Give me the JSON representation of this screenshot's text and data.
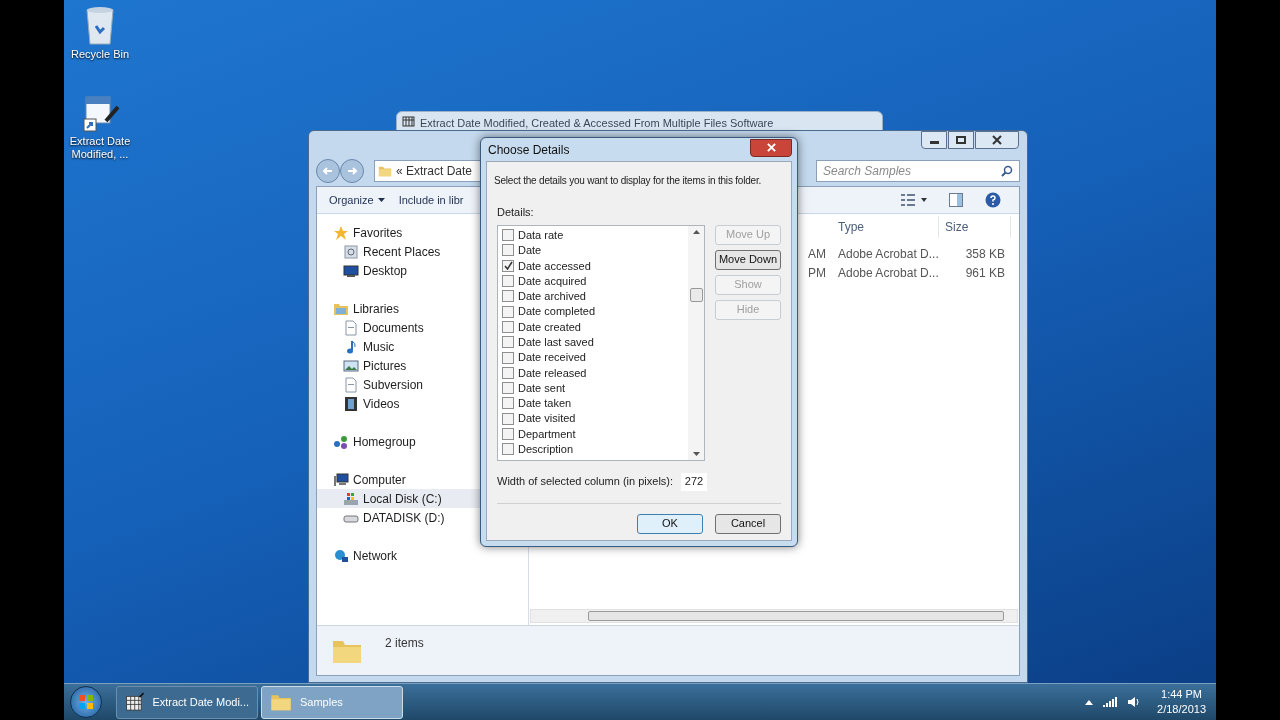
{
  "desktop_icons": [
    {
      "label": "Recycle Bin",
      "kind": "recycle"
    },
    {
      "label": "Extract Date Modified, ...",
      "kind": "shortcut"
    }
  ],
  "background_window": {
    "title": "Extract Date Modified, Created & Accessed From Multiple Files Software"
  },
  "explorer": {
    "address": "« Extract Date",
    "search_placeholder": "Search Samples",
    "toolbar": [
      {
        "label": "Organize",
        "dropdown": true
      },
      {
        "label": "Include in libr",
        "dropdown": false
      }
    ],
    "nav": [
      {
        "label": "Favorites",
        "kind": "star",
        "selected": false,
        "children": [
          {
            "label": "Recent Places",
            "kind": "recent",
            "selected": false
          },
          {
            "label": "Desktop",
            "kind": "desktop",
            "selected": false
          }
        ]
      },
      {
        "label": "Libraries",
        "kind": "library",
        "selected": false,
        "children": [
          {
            "label": "Documents",
            "kind": "document",
            "selected": false
          },
          {
            "label": "Music",
            "kind": "music",
            "selected": false
          },
          {
            "label": "Pictures",
            "kind": "pictures",
            "selected": false
          },
          {
            "label": "Subversion",
            "kind": "document",
            "selected": false
          },
          {
            "label": "Videos",
            "kind": "videos",
            "selected": false
          }
        ]
      },
      {
        "label": "Homegroup",
        "kind": "homegroup",
        "selected": false
      },
      {
        "label": "Computer",
        "kind": "computer",
        "selected": false,
        "children": [
          {
            "label": "Local Disk (C:)",
            "kind": "disk",
            "selected": true
          },
          {
            "label": "DATADISK (D:)",
            "kind": "drive",
            "selected": false
          }
        ]
      },
      {
        "label": "Network",
        "kind": "network",
        "selected": false
      }
    ],
    "columns": [
      "Type",
      "Size"
    ],
    "rows": [
      {
        "column_1": "AM",
        "type": "Adobe Acrobat D...",
        "size": "358 KB"
      },
      {
        "column_1": "PM",
        "type": "Adobe Acrobat D...",
        "size": "961 KB"
      }
    ],
    "status": "2 items"
  },
  "dialog": {
    "title": "Choose Details",
    "instruction": "Select the details you want to display for the items in this folder.",
    "details_label": "Details:",
    "items": [
      {
        "label": "Data rate",
        "checked": false
      },
      {
        "label": "Date",
        "checked": false
      },
      {
        "label": "Date accessed",
        "checked": true
      },
      {
        "label": "Date acquired",
        "checked": false
      },
      {
        "label": "Date archived",
        "checked": false
      },
      {
        "label": "Date completed",
        "checked": false
      },
      {
        "label": "Date created",
        "checked": false
      },
      {
        "label": "Date last saved",
        "checked": false
      },
      {
        "label": "Date received",
        "checked": false
      },
      {
        "label": "Date released",
        "checked": false
      },
      {
        "label": "Date sent",
        "checked": false
      },
      {
        "label": "Date taken",
        "checked": false
      },
      {
        "label": "Date visited",
        "checked": false
      },
      {
        "label": "Department",
        "checked": false
      },
      {
        "label": "Description",
        "checked": false
      }
    ],
    "side_buttons": [
      {
        "label": "Move Up",
        "disabled": true
      },
      {
        "label": "Move Down",
        "disabled": false
      },
      {
        "label": "Show",
        "disabled": true
      },
      {
        "label": "Hide",
        "disabled": true
      }
    ],
    "width_label": "Width of selected column (in pixels):",
    "width_value": "272",
    "actions": [
      {
        "label": "OK",
        "default": true
      },
      {
        "label": "Cancel",
        "default": false
      }
    ]
  },
  "taskbar": {
    "items": [
      {
        "label": "Extract Date Modi...",
        "kind": "app",
        "selected": false
      },
      {
        "label": "Samples",
        "kind": "folder",
        "selected": true
      }
    ],
    "time": "1:44 PM",
    "date": "2/18/2013"
  }
}
